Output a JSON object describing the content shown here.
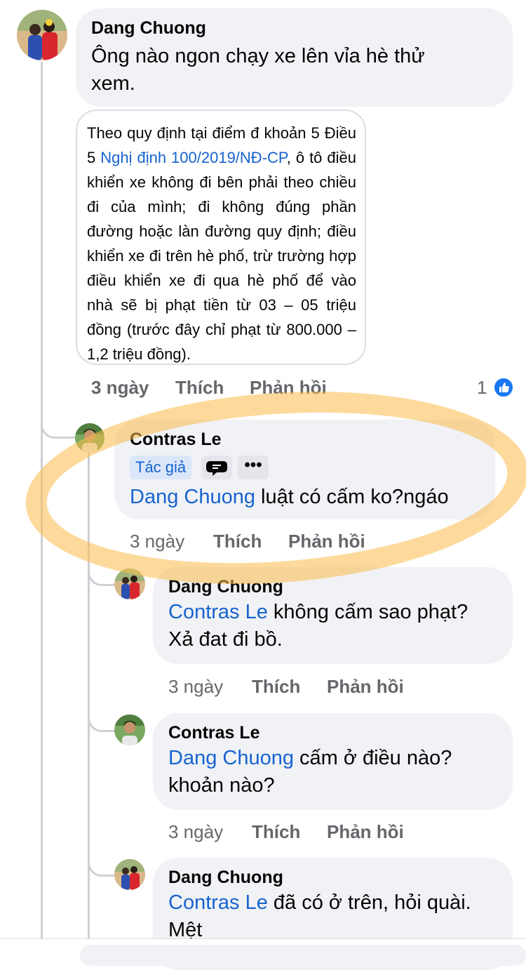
{
  "comments": [
    {
      "author": "Dang Chuong",
      "text": "Ông nào ngon chạy xe lên vỉa hè thử xem.",
      "text_line1": "Ông nào ngon chạy xe lên vỉa hè thử",
      "text_line2": "xem.",
      "attachment": {
        "before_link": "Theo quy định tại điểm đ khoản 5 Điều 5 ",
        "link": "Nghị định 100/2019/NĐ-CP",
        "after_link": ", ô tô điều khiển xe không đi bên phải theo chiều đi của mình; đi không đúng phần đường hoặc làn đường quy định; điều khiển xe đi trên hè phố, trừ trường hợp điều khiển xe đi qua hè phố để vào nhà sẽ bị phạt tiền từ 03 – 05 triệu đồng (trước đây chỉ phạt từ 800.000 – 1,2 triệu đồng)."
      },
      "time": "3 ngày",
      "like_label": "Thích",
      "reply_label": "Phản hồi",
      "reaction_count": "1"
    },
    {
      "author": "Contras Le",
      "badge": "Tác giả",
      "mention": "Dang Chuong",
      "text": " luật có cấm ko?ngáo",
      "time": "3 ngày",
      "like_label": "Thích",
      "reply_label": "Phản hồi"
    },
    {
      "author": "Dang Chuong",
      "mention": "Contras Le",
      "text_line1": " không cấm sao phạt?",
      "text_line2": "Xả đat đi bồ.",
      "time": "3 ngày",
      "like_label": "Thích",
      "reply_label": "Phản hồi"
    },
    {
      "author": "Contras Le",
      "mention": "Dang Chuong",
      "text_line1": " cấm ở điều nào?",
      "text_line2": "khoản nào?",
      "time": "3 ngày",
      "like_label": "Thích",
      "reply_label": "Phản hồi"
    },
    {
      "author": "Dang Chuong",
      "mention": "Contras Le",
      "text_line1": " đã có ở trên, hỏi quài.",
      "text_line2": "Mệt",
      "time": "",
      "like_label": "",
      "reply_label": ""
    }
  ],
  "colors": {
    "bubble": "#f0f2f5",
    "mention": "#1763cf",
    "like_blue": "#1877f2",
    "highlight": "#fcbc4a"
  },
  "icons": {
    "like_reaction": "thumbs-up-icon",
    "more": "more-dots-icon",
    "badge_extra": "chat-bubble-icon"
  }
}
